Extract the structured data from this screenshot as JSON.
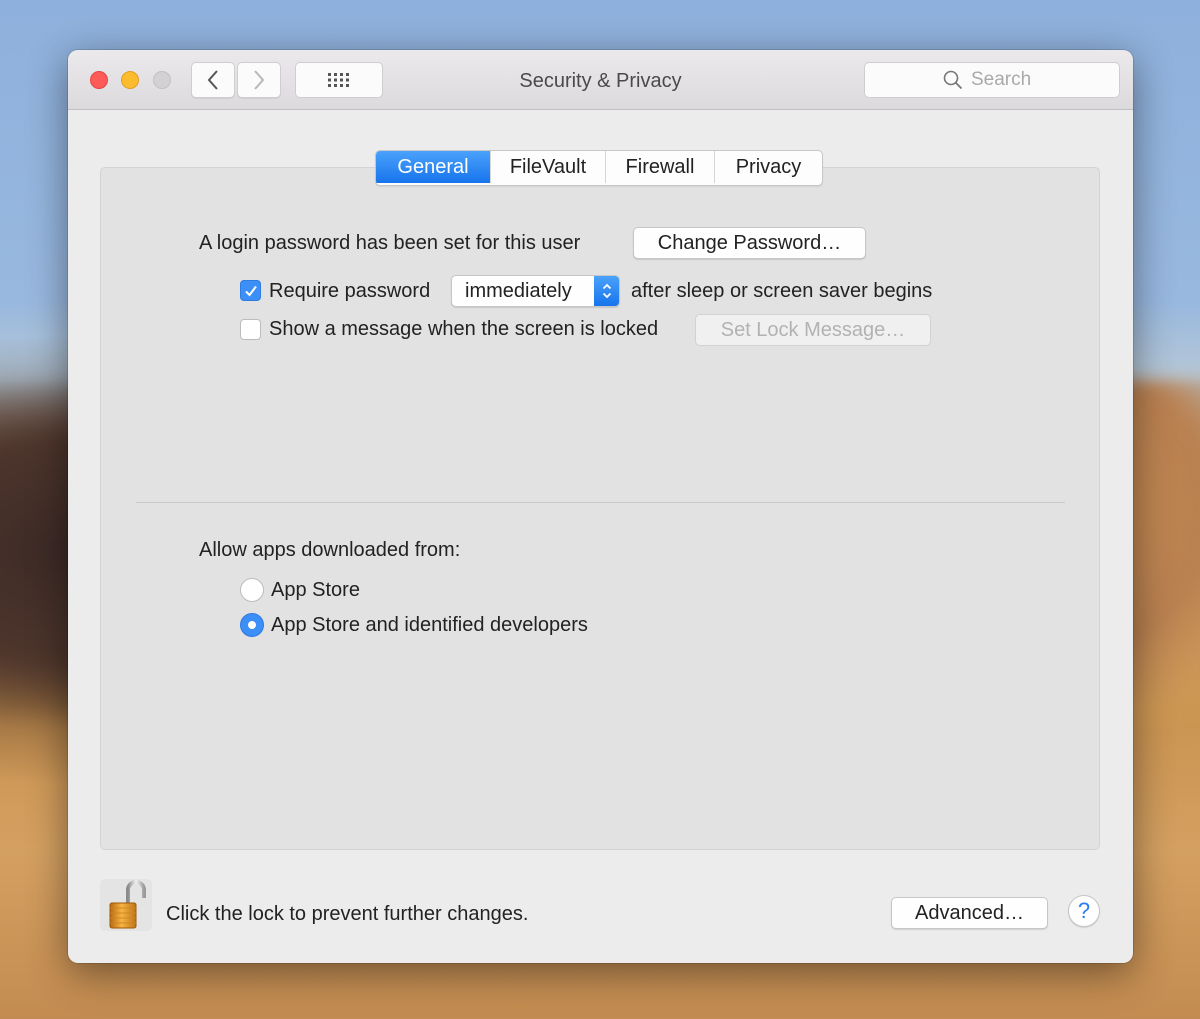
{
  "window": {
    "title": "Security & Privacy",
    "traffic_lights": [
      {
        "name": "close",
        "color": "#fc5b57"
      },
      {
        "name": "minimize",
        "color": "#fdbc2e"
      },
      {
        "name": "zoom",
        "color": "#d3d1d3"
      }
    ],
    "nav": {
      "back_icon": "chevron-left-icon",
      "forward_icon": "chevron-right-icon",
      "grid_icon": "show-all-grid-icon"
    },
    "search": {
      "placeholder": "Search",
      "value": "",
      "icon": "search-icon"
    }
  },
  "tabs": [
    {
      "label": "General",
      "active": true
    },
    {
      "label": "FileVault",
      "active": false
    },
    {
      "label": "Firewall",
      "active": false
    },
    {
      "label": "Privacy",
      "active": false
    }
  ],
  "general": {
    "login_password_text": "A login password has been set for this user",
    "change_password_button": "Change Password…",
    "require_password": {
      "checked": true,
      "label": "Require password",
      "delay_value": "immediately",
      "suffix": "after sleep or screen saver begins"
    },
    "show_message": {
      "checked": false,
      "label": "Show a message when the screen is locked",
      "button": "Set Lock Message…",
      "button_enabled": false
    },
    "allow_apps": {
      "heading": "Allow apps downloaded from:",
      "options": [
        {
          "label": "App Store",
          "selected": false
        },
        {
          "label": "App Store and identified developers",
          "selected": true
        }
      ]
    }
  },
  "footer": {
    "lock_icon": "unlocked-padlock-icon",
    "lock_text": "Click the lock to prevent further changes.",
    "advanced_button": "Advanced…",
    "help_button": "?"
  },
  "colors": {
    "accent": "#1f7ff0",
    "panel": "#e2e2e2",
    "window": "#ececec"
  }
}
